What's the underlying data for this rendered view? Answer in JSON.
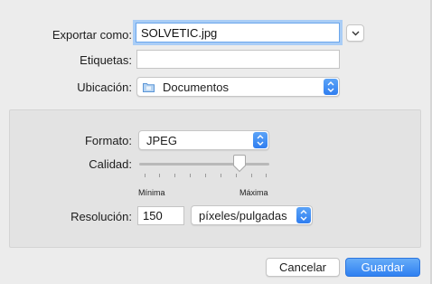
{
  "form": {
    "export_as_label": "Exportar como:",
    "export_as_value": "SOLVETIC.jpg",
    "tags_label": "Etiquetas:",
    "tags_value": "",
    "location_label": "Ubicación:",
    "location_value": "Documentos"
  },
  "options": {
    "format_label": "Formato:",
    "format_value": "JPEG",
    "quality_label": "Calidad:",
    "quality_value": 0.77,
    "quality_min_label": "Mínima",
    "quality_max_label": "Máxima",
    "resolution_label": "Resolución:",
    "resolution_value": "150",
    "resolution_unit": "píxeles/pulgadas"
  },
  "buttons": {
    "cancel_label": "Cancelar",
    "save_label": "Guardar"
  },
  "icons": {
    "location": "folder-icon",
    "popup_arrows": "up-down-chevron-icon",
    "disclosure": "chevron-down-icon",
    "slider_thumb": "slider-knob-icon"
  },
  "colors": {
    "accent": "#2f80f1",
    "focus_ring": "#a9cdf6",
    "dialog_background": "#ececec",
    "panel_background": "#e3e3e3"
  }
}
